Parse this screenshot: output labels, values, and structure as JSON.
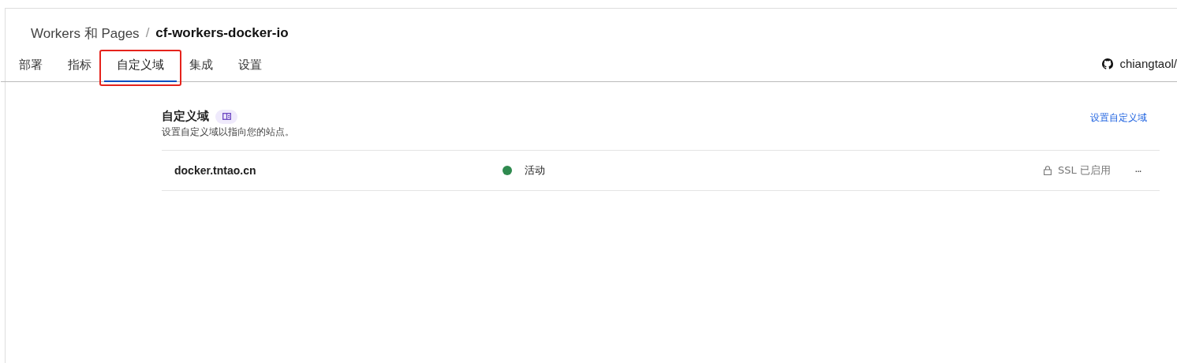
{
  "breadcrumb": {
    "parent": "Workers 和 Pages",
    "separator": "/",
    "current": "cf-workers-docker-io"
  },
  "tabs": [
    {
      "label": "部署",
      "selected": false
    },
    {
      "label": "指标",
      "selected": false
    },
    {
      "label": "自定义域",
      "selected": true
    },
    {
      "label": "集成",
      "selected": false
    },
    {
      "label": "设置",
      "selected": false
    }
  ],
  "repo": {
    "label": "chiangtaol/"
  },
  "section": {
    "title": "自定义域",
    "description": "设置自定义域以指向您的站点。",
    "action": "设置自定义域"
  },
  "domains": [
    {
      "name": "docker.tntao.cn",
      "status": "活动",
      "color": "#2f8a4f",
      "ssl": "SSL 已启用",
      "menu": "···"
    }
  ]
}
